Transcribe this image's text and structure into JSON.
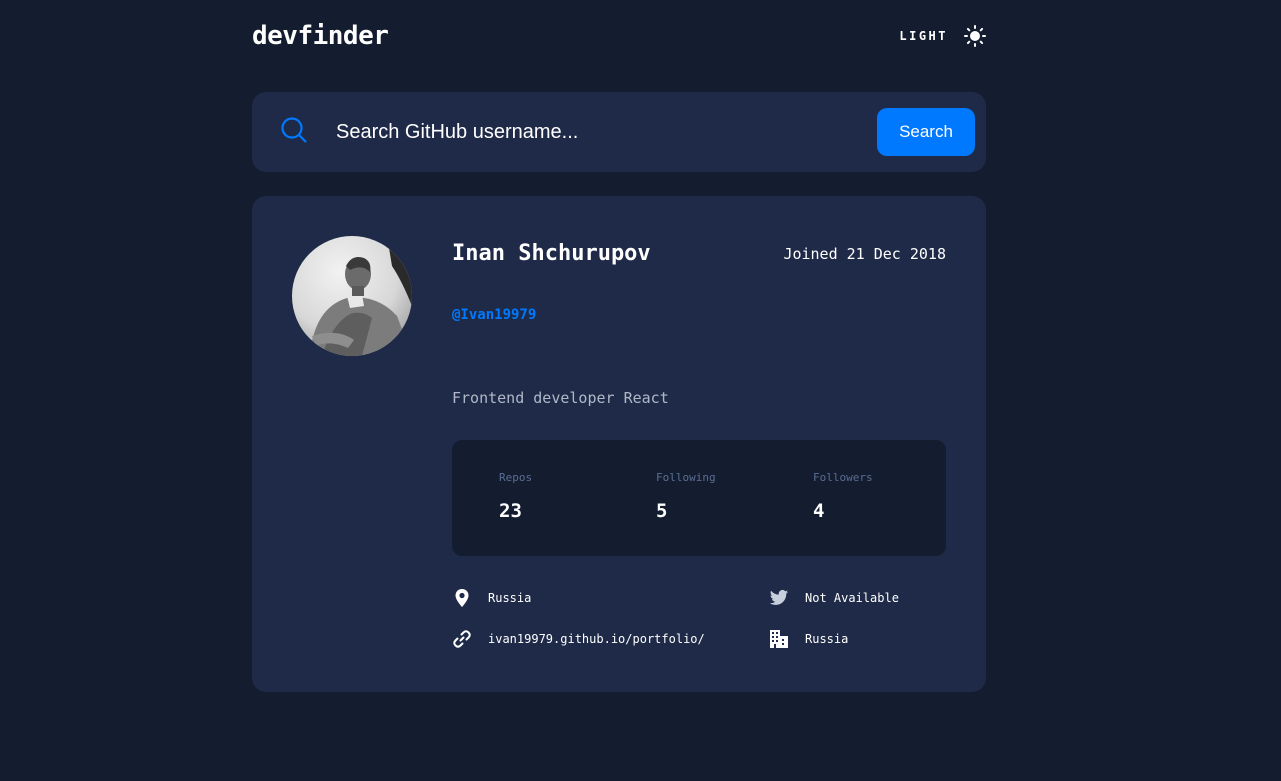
{
  "app": {
    "logo": "devfinder",
    "theme_toggle_label": "LIGHT",
    "theme_icon": "sun-icon"
  },
  "search": {
    "icon": "search-icon",
    "placeholder": "Search GitHub username...",
    "value": "",
    "button_label": "Search"
  },
  "profile": {
    "avatar_icon": "avatar",
    "name": "Inan Shchurupov",
    "joined": "Joined 21 Dec 2018",
    "handle": "@Ivan19979",
    "bio": "Frontend developer React",
    "stats": {
      "repos_label": "Repos",
      "repos_value": "23",
      "following_label": "Following",
      "following_value": "5",
      "followers_label": "Followers",
      "followers_value": "4"
    },
    "links": {
      "location": "Russia",
      "location_icon": "location-pin-icon",
      "website": "ivan19979.github.io/portfolio/",
      "website_icon": "link-icon",
      "twitter": "Not Available",
      "twitter_icon": "twitter-icon",
      "company": "Russia",
      "company_icon": "building-icon"
    }
  },
  "colors": {
    "background": "#141d2f",
    "card": "#1e2a47",
    "accent": "#0079ff",
    "muted": "#b0b8c8",
    "stat_label": "#5a6d94"
  }
}
